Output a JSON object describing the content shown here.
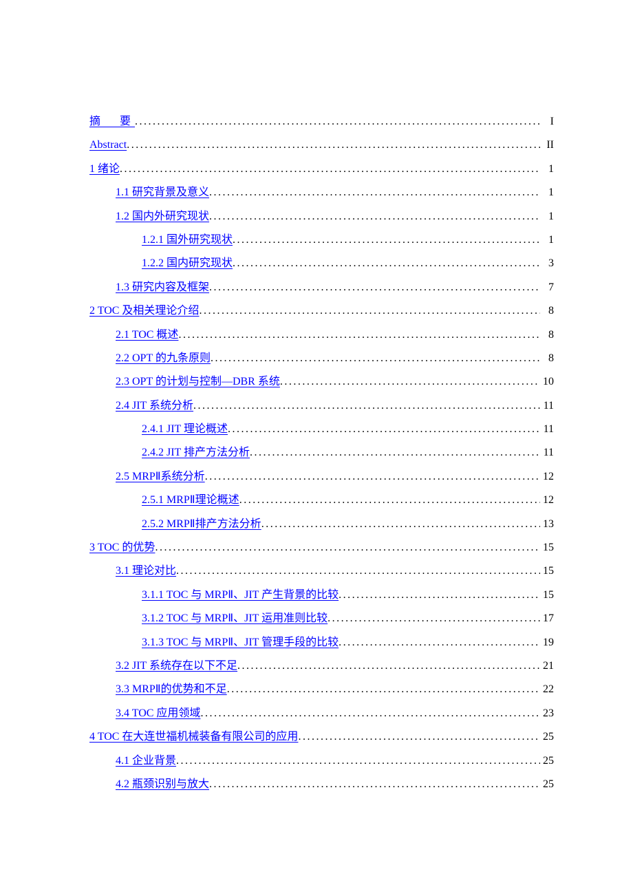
{
  "toc": [
    {
      "level": 0,
      "label": "摘　要",
      "page": "I",
      "letterSp": true
    },
    {
      "level": 0,
      "label": "Abstract",
      "page": "II"
    },
    {
      "level": 0,
      "label": "1  绪论",
      "page": "1"
    },
    {
      "level": 1,
      "label": "1.1  研究背景及意义",
      "page": "1"
    },
    {
      "level": 1,
      "label": "1.2  国内外研究现状",
      "page": "1"
    },
    {
      "level": 2,
      "label": "1.2.1  国外研究现状",
      "page": "1"
    },
    {
      "level": 2,
      "label": "1.2.2  国内研究现状",
      "page": "3"
    },
    {
      "level": 1,
      "label": "1.3  研究内容及框架",
      "page": "7"
    },
    {
      "level": 0,
      "label": "2  TOC 及相关理论介绍",
      "page": "8"
    },
    {
      "level": 1,
      "label": "2.1  TOC 概述",
      "page": "8"
    },
    {
      "level": 1,
      "label": "2.2  OPT 的九条原则",
      "page": "8"
    },
    {
      "level": 1,
      "label": "2.3  OPT 的计划与控制—DBR 系统",
      "page": "10"
    },
    {
      "level": 1,
      "label": "2.4  JIT 系统分析",
      "page": "11"
    },
    {
      "level": 2,
      "label": "2.4.1  JIT 理论概述",
      "page": "11"
    },
    {
      "level": 2,
      "label": "2.4.2  JIT 排产方法分析",
      "page": "11"
    },
    {
      "level": 1,
      "label": "2.5  MRPⅡ系统分析",
      "page": "12"
    },
    {
      "level": 2,
      "label": "2.5.1  MRPⅡ理论概述",
      "page": "12"
    },
    {
      "level": 2,
      "label": "2.5.2  MRPⅡ排产方法分析",
      "page": "13"
    },
    {
      "level": 0,
      "label": "3  TOC 的优势",
      "page": "15"
    },
    {
      "level": 1,
      "label": "3.1  理论对比",
      "page": "15"
    },
    {
      "level": 2,
      "label": "3.1.1  TOC 与 MRPⅡ、JIT 产生背景的比较",
      "page": "15"
    },
    {
      "level": 2,
      "label": "3.1.2  TOC 与 MRPⅡ、JIT 运用准则比较",
      "page": "17"
    },
    {
      "level": 2,
      "label": "3.1.3  TOC 与 MRPⅡ、JIT 管理手段的比较",
      "page": "19"
    },
    {
      "level": 1,
      "label": "3.2  JIT 系统存在以下不足",
      "page": "21"
    },
    {
      "level": 1,
      "label": "3.3  MRPⅡ的优势和不足",
      "page": "22"
    },
    {
      "level": 1,
      "label": "3.4  TOC 应用领域",
      "page": "23"
    },
    {
      "level": 0,
      "label": "4  TOC 在大连世福机械装备有限公司的应用",
      "page": "25"
    },
    {
      "level": 1,
      "label": "4.1  企业背景",
      "page": "25"
    },
    {
      "level": 1,
      "label": "4.2  瓶颈识别与放大",
      "page": "25"
    }
  ]
}
